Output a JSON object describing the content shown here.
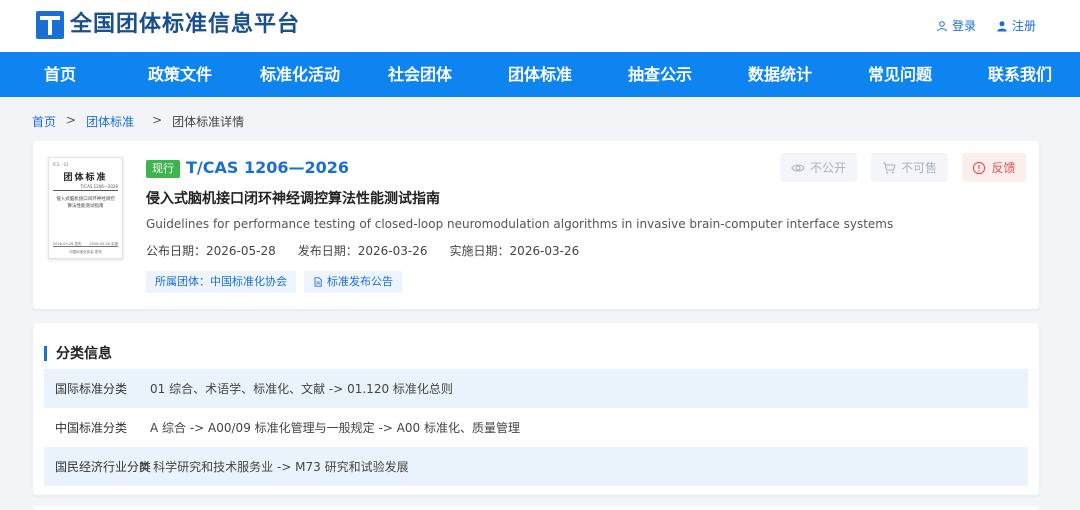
{
  "site": {
    "title": "全国团体标准信息平台"
  },
  "auth": {
    "login": "登录",
    "register": "注册"
  },
  "nav": [
    "首页",
    "政策文件",
    "标准化活动",
    "社会团体",
    "团体标准",
    "抽查公示",
    "数据统计",
    "常见问题",
    "联系我们"
  ],
  "breadcrumb": {
    "home": "首页",
    "sep": ">",
    "section": "团体标准",
    "current": "团体标准详情"
  },
  "standard": {
    "status": "现行",
    "code": "T/CAS 1206—2026",
    "title_cn": "侵入式脑机接口闭环神经调控算法性能测试指南",
    "title_en": "Guidelines for performance testing of closed-loop neuromodulation algorithms in invasive brain-computer interface systems",
    "dates": [
      {
        "label": "公布日期：",
        "value": "2026-05-28"
      },
      {
        "label": "发布日期：",
        "value": "2026-03-26"
      },
      {
        "label": "实施日期：",
        "value": "2026-03-26"
      }
    ],
    "tags": {
      "org": "所属团体：中国标准化协会",
      "notice": "标准发布公告"
    },
    "actions": {
      "private": "不公开",
      "not_for_sale": "不可售",
      "feedback": "反馈"
    },
    "cover": {
      "top": "ICS　01",
      "title": "团体标准",
      "code": "T/CAS 1206—2026",
      "name": "侵入式脑机接口闭环神经调控算法性能测试指南",
      "date_left": "2026-03-26 发布",
      "date_right": "2026-03-26 实施",
      "publisher": "中国标准化协会 发布"
    }
  },
  "classification": {
    "title": "分类信息",
    "rows": [
      {
        "label": "国际标准分类",
        "value": "01 综合、术语学、标准化、文献 -> 01.120 标准化总则"
      },
      {
        "label": "中国标准分类",
        "value": "A 综合 -> A00/09 标准化管理与一般规定 -> A00 标准化、质量管理"
      },
      {
        "label": "国民经济行业分类",
        "value": "M 科学研究和技术服务业 -> M73 研究和试验发展"
      }
    ]
  },
  "colors": {
    "brand": "#0d84f0",
    "accent": "#1a6fd4",
    "status": "#3fb34f",
    "danger": "#e0534f"
  }
}
